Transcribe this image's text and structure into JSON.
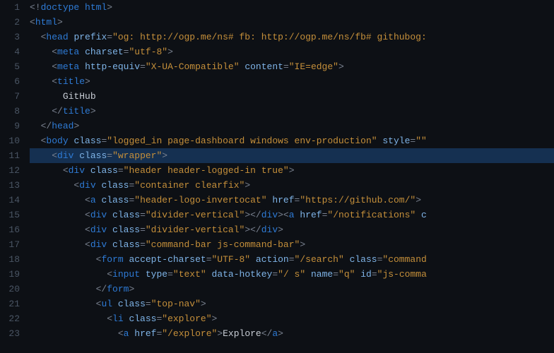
{
  "editor": {
    "highlighted_line": 11,
    "lines": [
      {
        "num": 1,
        "indent": 0,
        "tokens": [
          [
            "punc",
            "<!"
          ],
          [
            "tag",
            "doctype html"
          ],
          [
            "punc",
            ">"
          ]
        ]
      },
      {
        "num": 2,
        "indent": 0,
        "tokens": [
          [
            "punc",
            "<"
          ],
          [
            "tag",
            "html"
          ],
          [
            "punc",
            ">"
          ]
        ]
      },
      {
        "num": 3,
        "indent": 1,
        "tokens": [
          [
            "punc",
            "<"
          ],
          [
            "tag",
            "head"
          ],
          [
            "txt",
            " "
          ],
          [
            "attr",
            "prefix"
          ],
          [
            "punc",
            "="
          ],
          [
            "str",
            "\"og: http://ogp.me/ns# fb: http://ogp.me/ns/fb# githubog:"
          ]
        ]
      },
      {
        "num": 4,
        "indent": 2,
        "tokens": [
          [
            "punc",
            "<"
          ],
          [
            "tag",
            "meta"
          ],
          [
            "txt",
            " "
          ],
          [
            "attr",
            "charset"
          ],
          [
            "punc",
            "="
          ],
          [
            "str",
            "\"utf-8\""
          ],
          [
            "punc",
            ">"
          ]
        ]
      },
      {
        "num": 5,
        "indent": 2,
        "tokens": [
          [
            "punc",
            "<"
          ],
          [
            "tag",
            "meta"
          ],
          [
            "txt",
            " "
          ],
          [
            "attr",
            "http-equiv"
          ],
          [
            "punc",
            "="
          ],
          [
            "str",
            "\"X-UA-Compatible\""
          ],
          [
            "txt",
            " "
          ],
          [
            "attr",
            "content"
          ],
          [
            "punc",
            "="
          ],
          [
            "str",
            "\"IE=edge\""
          ],
          [
            "punc",
            ">"
          ]
        ]
      },
      {
        "num": 6,
        "indent": 2,
        "tokens": [
          [
            "punc",
            "<"
          ],
          [
            "tag",
            "title"
          ],
          [
            "punc",
            ">"
          ]
        ]
      },
      {
        "num": 7,
        "indent": 3,
        "tokens": [
          [
            "txt",
            "GitHub"
          ]
        ]
      },
      {
        "num": 8,
        "indent": 2,
        "tokens": [
          [
            "punc",
            "</"
          ],
          [
            "tag",
            "title"
          ],
          [
            "punc",
            ">"
          ]
        ]
      },
      {
        "num": 9,
        "indent": 1,
        "tokens": [
          [
            "punc",
            "</"
          ],
          [
            "tag",
            "head"
          ],
          [
            "punc",
            ">"
          ]
        ]
      },
      {
        "num": 10,
        "indent": 1,
        "tokens": [
          [
            "punc",
            "<"
          ],
          [
            "tag",
            "body"
          ],
          [
            "txt",
            " "
          ],
          [
            "attr",
            "class"
          ],
          [
            "punc",
            "="
          ],
          [
            "str",
            "\"logged_in page-dashboard windows env-production\""
          ],
          [
            "txt",
            " "
          ],
          [
            "attr",
            "style"
          ],
          [
            "punc",
            "="
          ],
          [
            "str",
            "\"\""
          ]
        ]
      },
      {
        "num": 11,
        "indent": 2,
        "tokens": [
          [
            "punc",
            "<"
          ],
          [
            "tag",
            "div"
          ],
          [
            "txt",
            " "
          ],
          [
            "attr",
            "class"
          ],
          [
            "punc",
            "="
          ],
          [
            "str",
            "\"wrapper\""
          ],
          [
            "punc",
            ">"
          ]
        ]
      },
      {
        "num": 12,
        "indent": 3,
        "tokens": [
          [
            "punc",
            "<"
          ],
          [
            "tag",
            "div"
          ],
          [
            "txt",
            " "
          ],
          [
            "attr",
            "class"
          ],
          [
            "punc",
            "="
          ],
          [
            "str",
            "\"header header-logged-in true\""
          ],
          [
            "punc",
            ">"
          ]
        ]
      },
      {
        "num": 13,
        "indent": 4,
        "tokens": [
          [
            "punc",
            "<"
          ],
          [
            "tag",
            "div"
          ],
          [
            "txt",
            " "
          ],
          [
            "attr",
            "class"
          ],
          [
            "punc",
            "="
          ],
          [
            "str",
            "\"container clearfix\""
          ],
          [
            "punc",
            ">"
          ]
        ]
      },
      {
        "num": 14,
        "indent": 5,
        "tokens": [
          [
            "punc",
            "<"
          ],
          [
            "tag",
            "a"
          ],
          [
            "txt",
            " "
          ],
          [
            "attr",
            "class"
          ],
          [
            "punc",
            "="
          ],
          [
            "str",
            "\"header-logo-invertocat\""
          ],
          [
            "txt",
            " "
          ],
          [
            "attr",
            "href"
          ],
          [
            "punc",
            "="
          ],
          [
            "str",
            "\"https://github.com/\""
          ],
          [
            "punc",
            ">"
          ]
        ]
      },
      {
        "num": 15,
        "indent": 5,
        "tokens": [
          [
            "punc",
            "<"
          ],
          [
            "tag",
            "div"
          ],
          [
            "txt",
            " "
          ],
          [
            "attr",
            "class"
          ],
          [
            "punc",
            "="
          ],
          [
            "str",
            "\"divider-vertical\""
          ],
          [
            "punc",
            "></"
          ],
          [
            "tag",
            "div"
          ],
          [
            "punc",
            "><"
          ],
          [
            "tag",
            "a"
          ],
          [
            "txt",
            " "
          ],
          [
            "attr",
            "href"
          ],
          [
            "punc",
            "="
          ],
          [
            "str",
            "\"/notifications\""
          ],
          [
            "txt",
            " "
          ],
          [
            "attr",
            "c"
          ]
        ]
      },
      {
        "num": 16,
        "indent": 5,
        "tokens": [
          [
            "punc",
            "<"
          ],
          [
            "tag",
            "div"
          ],
          [
            "txt",
            " "
          ],
          [
            "attr",
            "class"
          ],
          [
            "punc",
            "="
          ],
          [
            "str",
            "\"divider-vertical\""
          ],
          [
            "punc",
            "></"
          ],
          [
            "tag",
            "div"
          ],
          [
            "punc",
            ">"
          ]
        ]
      },
      {
        "num": 17,
        "indent": 5,
        "tokens": [
          [
            "punc",
            "<"
          ],
          [
            "tag",
            "div"
          ],
          [
            "txt",
            " "
          ],
          [
            "attr",
            "class"
          ],
          [
            "punc",
            "="
          ],
          [
            "str",
            "\"command-bar js-command-bar\""
          ],
          [
            "punc",
            ">"
          ]
        ]
      },
      {
        "num": 18,
        "indent": 6,
        "tokens": [
          [
            "punc",
            "<"
          ],
          [
            "tag",
            "form"
          ],
          [
            "txt",
            " "
          ],
          [
            "attr",
            "accept-charset"
          ],
          [
            "punc",
            "="
          ],
          [
            "str",
            "\"UTF-8\""
          ],
          [
            "txt",
            " "
          ],
          [
            "attr",
            "action"
          ],
          [
            "punc",
            "="
          ],
          [
            "str",
            "\"/search\""
          ],
          [
            "txt",
            " "
          ],
          [
            "attr",
            "class"
          ],
          [
            "punc",
            "="
          ],
          [
            "str",
            "\"command"
          ]
        ]
      },
      {
        "num": 19,
        "indent": 7,
        "tokens": [
          [
            "punc",
            "<"
          ],
          [
            "tag",
            "input"
          ],
          [
            "txt",
            " "
          ],
          [
            "attr",
            "type"
          ],
          [
            "punc",
            "="
          ],
          [
            "str",
            "\"text\""
          ],
          [
            "txt",
            " "
          ],
          [
            "attr",
            "data-hotkey"
          ],
          [
            "punc",
            "="
          ],
          [
            "str",
            "\"/ s\""
          ],
          [
            "txt",
            " "
          ],
          [
            "attr",
            "name"
          ],
          [
            "punc",
            "="
          ],
          [
            "str",
            "\"q\""
          ],
          [
            "txt",
            " "
          ],
          [
            "attr",
            "id"
          ],
          [
            "punc",
            "="
          ],
          [
            "str",
            "\"js-comma"
          ]
        ]
      },
      {
        "num": 20,
        "indent": 6,
        "tokens": [
          [
            "punc",
            "</"
          ],
          [
            "tag",
            "form"
          ],
          [
            "punc",
            ">"
          ]
        ]
      },
      {
        "num": 21,
        "indent": 6,
        "tokens": [
          [
            "punc",
            "<"
          ],
          [
            "tag",
            "ul"
          ],
          [
            "txt",
            " "
          ],
          [
            "attr",
            "class"
          ],
          [
            "punc",
            "="
          ],
          [
            "str",
            "\"top-nav\""
          ],
          [
            "punc",
            ">"
          ]
        ]
      },
      {
        "num": 22,
        "indent": 7,
        "tokens": [
          [
            "punc",
            "<"
          ],
          [
            "tag",
            "li"
          ],
          [
            "txt",
            " "
          ],
          [
            "attr",
            "class"
          ],
          [
            "punc",
            "="
          ],
          [
            "str",
            "\"explore\""
          ],
          [
            "punc",
            ">"
          ]
        ]
      },
      {
        "num": 23,
        "indent": 8,
        "tokens": [
          [
            "punc",
            "<"
          ],
          [
            "tag",
            "a"
          ],
          [
            "txt",
            " "
          ],
          [
            "attr",
            "href"
          ],
          [
            "punc",
            "="
          ],
          [
            "str",
            "\"/explore\""
          ],
          [
            "punc",
            ">"
          ],
          [
            "txt",
            "Explore"
          ],
          [
            "punc",
            "</"
          ],
          [
            "tag",
            "a"
          ],
          [
            "punc",
            ">"
          ]
        ]
      }
    ]
  }
}
